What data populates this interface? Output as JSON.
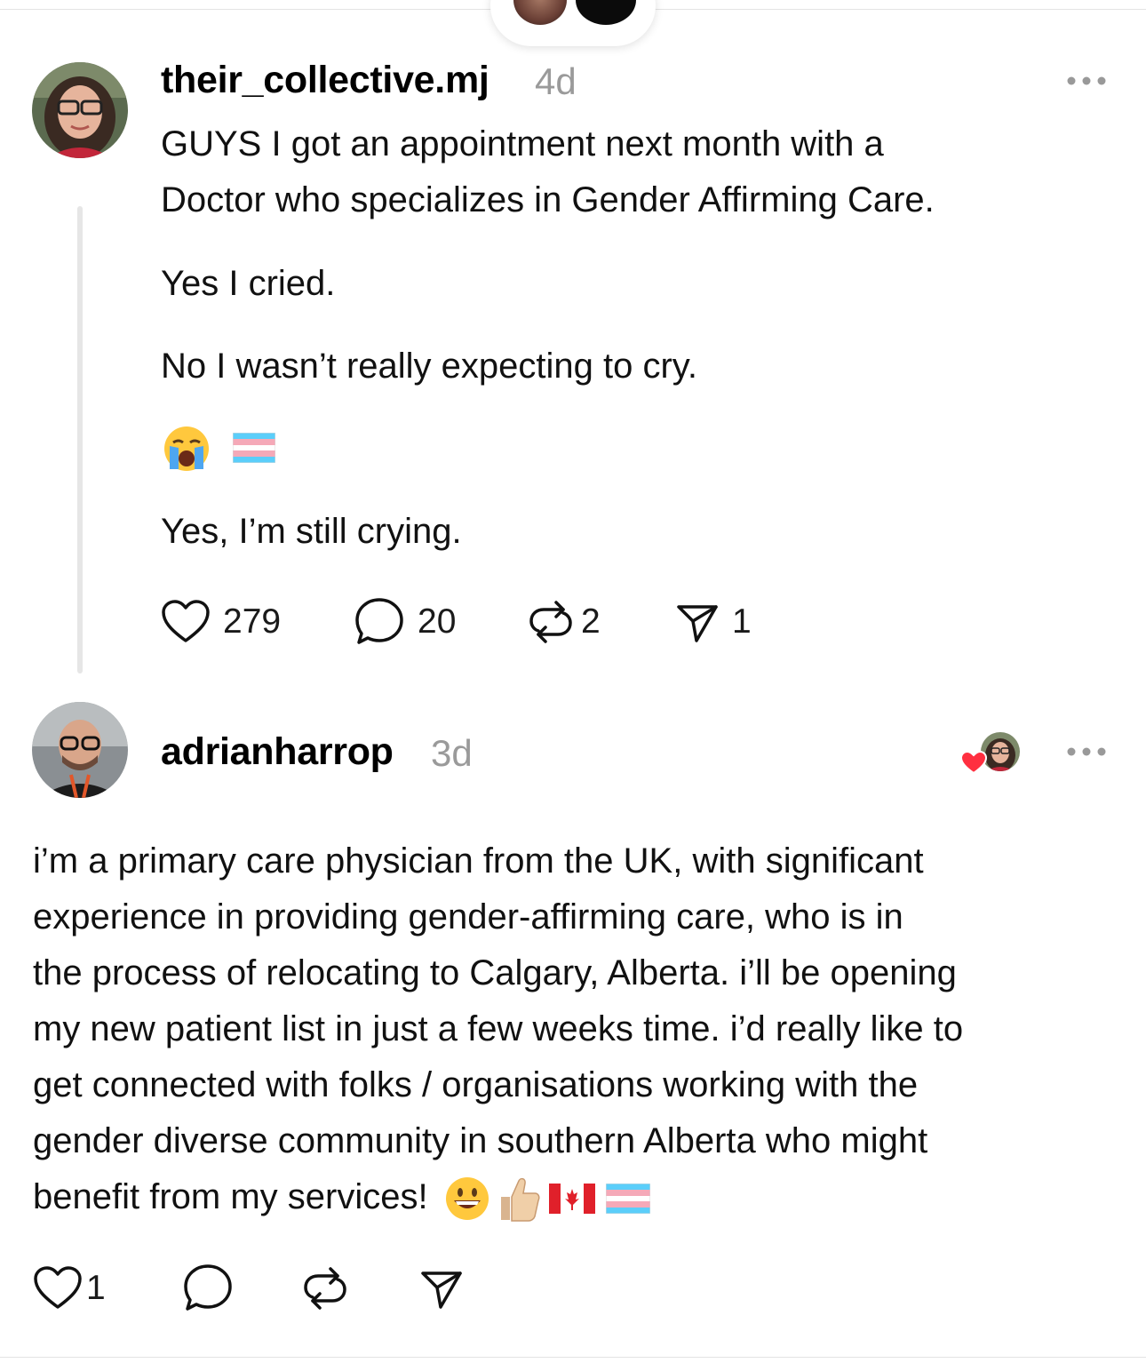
{
  "post1": {
    "username": "their_collective.mj",
    "timestamp": "4d",
    "text_line1": "GUYS I got an appointment next month with a",
    "text_line2": "Doctor who specializes in Gender Affirming Care.",
    "text_line3": "Yes I cried.",
    "text_line4": "No I wasn’t really expecting to cry.",
    "text_line5": "Yes, I’m still crying.",
    "emojis": [
      "crying-face",
      "transgender-flag"
    ],
    "likes": "279",
    "comments": "20",
    "reposts": "2",
    "shares": "1"
  },
  "post2": {
    "username": "adrianharrop",
    "timestamp": "3d",
    "text_lines": [
      "i’m a primary care physician from the UK, with significant",
      "experience in providing gender-affirming care, who is in",
      "the process of relocating to Calgary, Alberta. i’ll be opening",
      "my new patient list in just a few weeks time. i’d really like to",
      "get connected with folks / organisations working with the",
      "gender diverse community in southern Alberta who might",
      "benefit from my services!"
    ],
    "trailing_emojis": [
      "grinning-face",
      "thumbs-up",
      "canada-flag",
      "transgender-flag"
    ],
    "likes": "1"
  },
  "colors": {
    "timestamp": "#9a9a9a",
    "heart_red": "#ff2f40",
    "trans_blue": "#5bcefa",
    "trans_pink": "#f5a9b8"
  }
}
